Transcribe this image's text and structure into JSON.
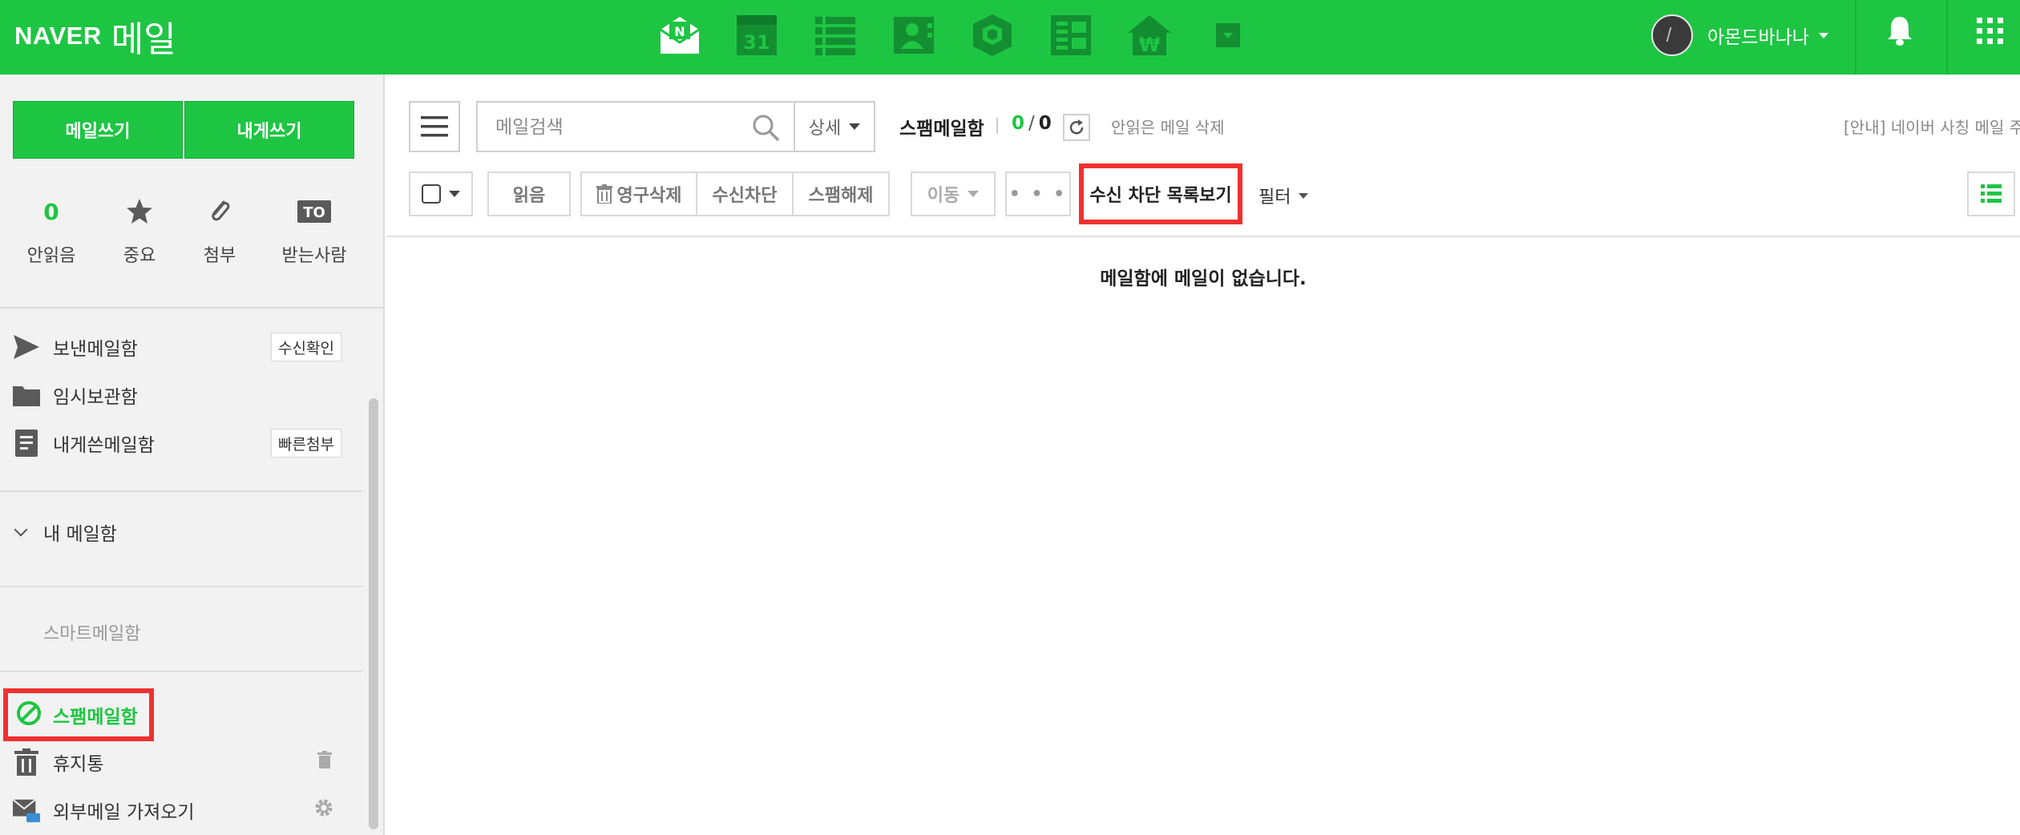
{
  "colors": {
    "brand_green": "#1ec543",
    "highlight_red": "#f03030"
  },
  "header": {
    "logo_naver": "NAVER",
    "logo_mail": "메일",
    "apps": [
      "mail-icon",
      "calendar-icon",
      "list-icon",
      "contacts-icon",
      "box-icon",
      "memo-icon",
      "won-icon",
      "more-dropdown-icon"
    ],
    "calendar_day": "31",
    "mail_badge": "N",
    "user_name": "아몬드바나나"
  },
  "sidebar": {
    "write_button": "메일쓰기",
    "self_write_button": "내게쓰기",
    "quick": [
      {
        "label": "안읽음",
        "count": "0"
      },
      {
        "label": "중요",
        "icon": "star-icon"
      },
      {
        "label": "첨부",
        "icon": "paperclip-icon"
      },
      {
        "label": "받는사람",
        "icon": "to-icon",
        "icon_text": "TO"
      }
    ],
    "folders": [
      {
        "label": "보낸메일함",
        "tag": "수신확인",
        "icon": "send-icon"
      },
      {
        "label": "임시보관함",
        "icon": "folder-icon"
      },
      {
        "label": "내게쓴메일함",
        "tag": "빠른첨부",
        "icon": "note-icon"
      }
    ],
    "my_folder": "내 메일함",
    "smart_folder": "스마트메일함",
    "spam_folder": "스팸메일함",
    "trash": "휴지통",
    "external": "외부메일 가져오기"
  },
  "main": {
    "search_placeholder": "메일검색",
    "detail_label": "상세",
    "mailbox_name": "스팸메일함",
    "unread_count": "0",
    "total_count": "0",
    "count_separator": "/",
    "delete_unread": "안읽은 메일 삭제",
    "notice": "[안내] 네이버 사칭 메일 주의",
    "toolbar": {
      "read": "읽음",
      "permanent_delete": "영구삭제",
      "block": "수신차단",
      "unspam": "스팸해제",
      "move": "이동",
      "more": "• • •",
      "block_list": "수신 차단 목록보기",
      "filter": "필터"
    },
    "empty_message": "메일함에 메일이 없습니다."
  }
}
